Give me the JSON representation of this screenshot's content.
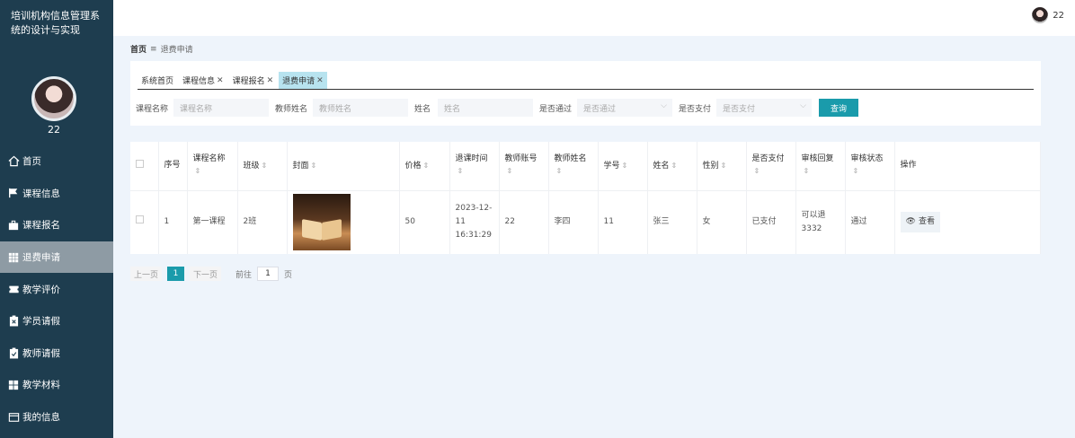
{
  "app": {
    "title": "培训机构信息管理系统的设计与实现",
    "username": "22"
  },
  "topbar": {
    "username": "22"
  },
  "menu": [
    {
      "label": "首页",
      "icon": "home-icon"
    },
    {
      "label": "课程信息",
      "icon": "flag-icon"
    },
    {
      "label": "课程报名",
      "icon": "briefcase-icon"
    },
    {
      "label": "退费申请",
      "icon": "grid-icon"
    },
    {
      "label": "教学评价",
      "icon": "ticket-icon"
    },
    {
      "label": "学员请假",
      "icon": "clipboard-x-icon"
    },
    {
      "label": "教师请假",
      "icon": "clipboard-check-icon"
    },
    {
      "label": "教学材料",
      "icon": "apps-icon"
    },
    {
      "label": "我的信息",
      "icon": "id-card-icon"
    }
  ],
  "breadcrumb": {
    "home": "首页",
    "separator": "≡",
    "current": "退费申请"
  },
  "tabs": [
    {
      "label": "系统首页",
      "closable": false
    },
    {
      "label": "课程信息",
      "closable": true
    },
    {
      "label": "课程报名",
      "closable": true
    },
    {
      "label": "退费申请",
      "closable": true
    }
  ],
  "search": {
    "course_name_label": "课程名称",
    "course_name_placeholder": "课程名称",
    "teacher_name_label": "教师姓名",
    "teacher_name_placeholder": "教师姓名",
    "name_label": "姓名",
    "name_placeholder": "姓名",
    "approved_label": "是否通过",
    "approved_placeholder": "是否通过",
    "paid_label": "是否支付",
    "paid_placeholder": "是否支付",
    "query_button": "查询"
  },
  "table": {
    "headers": [
      "序号",
      "课程名称",
      "班级",
      "封面",
      "价格",
      "退课时间",
      "教师账号",
      "教师姓名",
      "学号",
      "姓名",
      "性别",
      "是否支付",
      "审核回复",
      "审核状态",
      "操作"
    ],
    "rows": [
      {
        "index": "1",
        "course": "第一课程",
        "class": "2班",
        "price": "50",
        "time": "2023-12-11 16:31:29",
        "teacher_account": "22",
        "teacher_name": "李四",
        "student_no": "11",
        "name": "张三",
        "gender": "女",
        "paid": "已支付",
        "reply": "可以退3332",
        "status": "通过",
        "action": "查看"
      }
    ]
  },
  "pager": {
    "prev": "上一页",
    "current": "1",
    "next": "下一页",
    "goto_label": "前往",
    "goto_value": "1",
    "page_unit": "页"
  },
  "colors": {
    "sidebar": "#1e3d4f",
    "accent": "#1a9bab",
    "active_tab": "#b7e3ef",
    "background": "#eef4fb"
  }
}
